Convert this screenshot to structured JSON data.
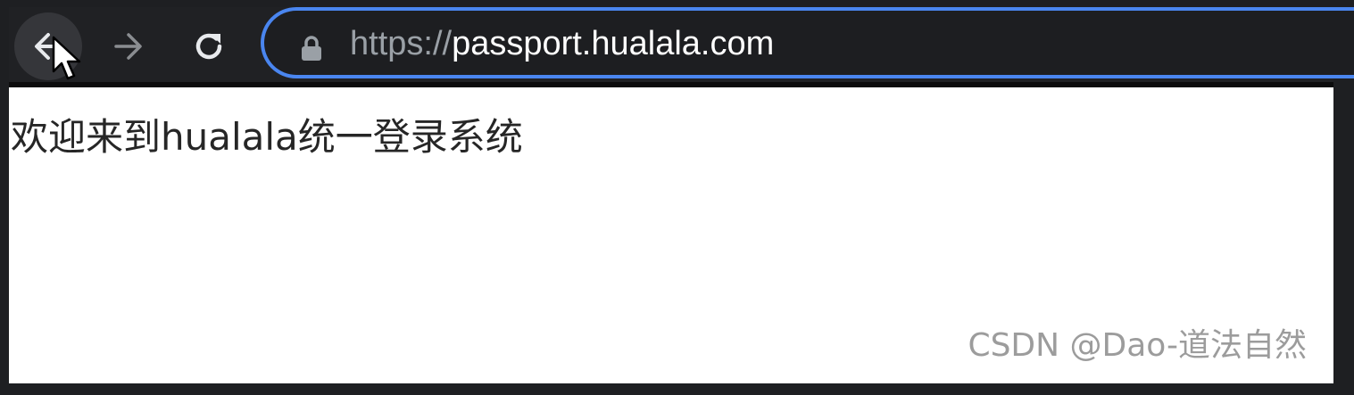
{
  "browser": {
    "nav": {
      "back_icon": "arrow-left-icon",
      "forward_icon": "arrow-right-icon",
      "reload_icon": "reload-icon"
    },
    "omnibox": {
      "lock_icon": "lock-icon",
      "url_scheme": "https://",
      "url_host": "passport.hualala.com",
      "focus_color": "#4a86f0"
    },
    "cursor_icon": "mouse-pointer-icon"
  },
  "page": {
    "heading": "欢迎来到hualala统一登录系统"
  },
  "watermark": {
    "text": "CSDN @Dao-道法自然"
  },
  "colors": {
    "toolbar_bg": "#202124",
    "page_bg": "#ffffff",
    "frame_bg": "#1e1f22"
  }
}
